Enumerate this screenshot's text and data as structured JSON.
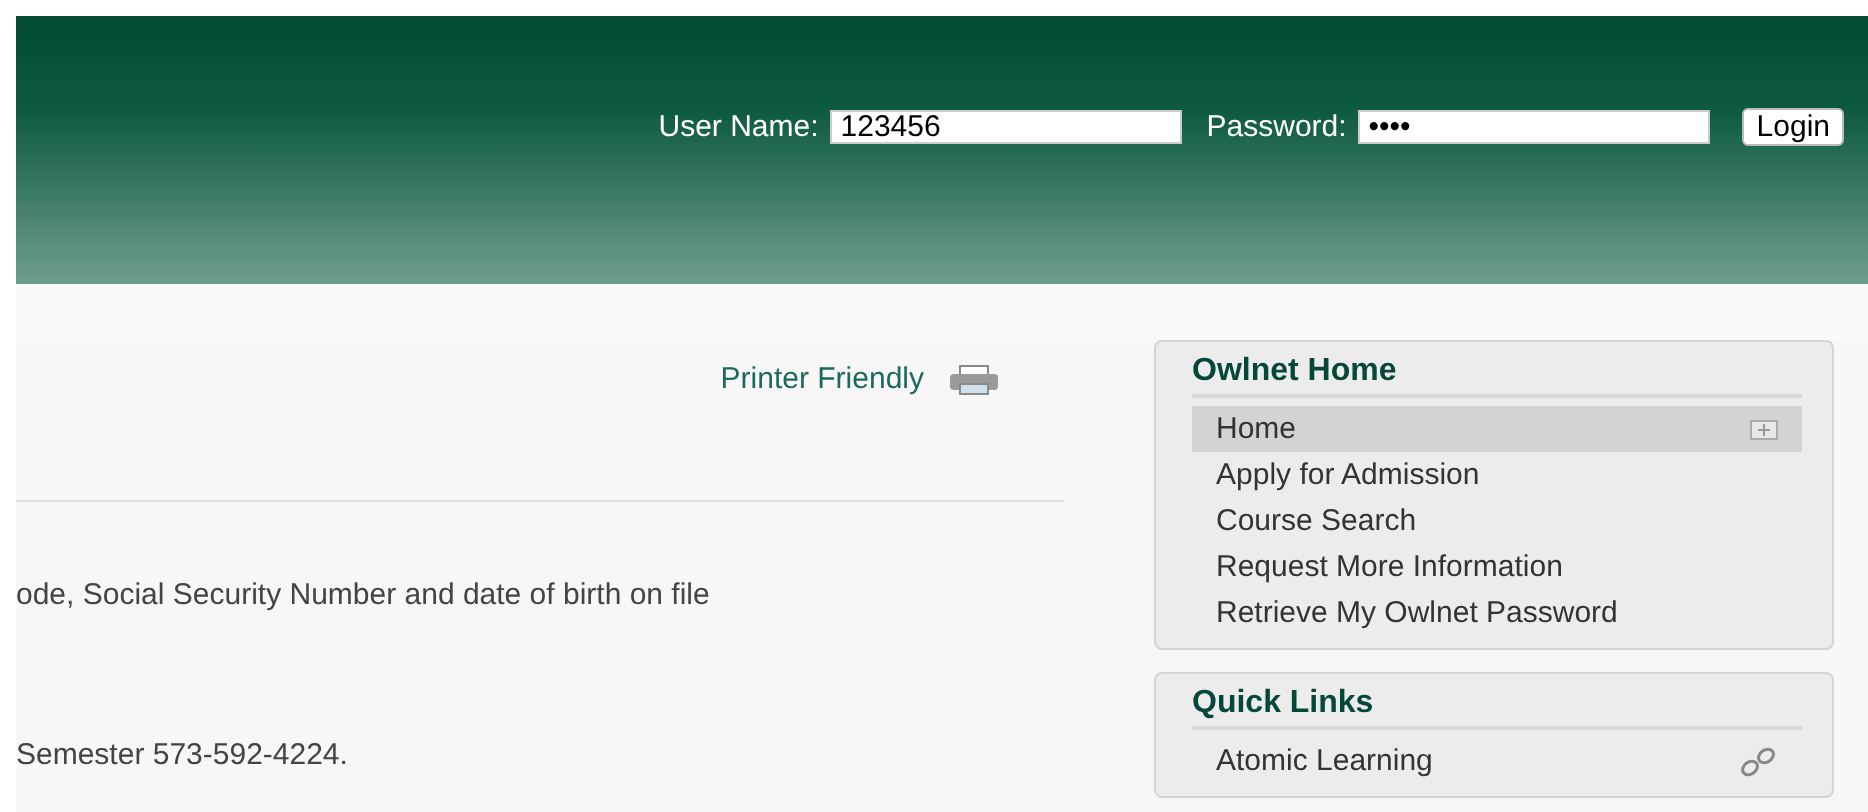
{
  "header": {
    "login": {
      "username_label": "User Name:",
      "username_value": "123456",
      "password_label": "Password:",
      "password_value": "••••",
      "button": "Login"
    }
  },
  "content": {
    "printer_link": "Printer Friendly",
    "paragraphs": [
      "ode, Social Security Number and date of birth on file",
      "Semester 573-592-4224."
    ]
  },
  "sidebar": [
    {
      "title": "Owlnet Home",
      "kind": "nav",
      "items": [
        {
          "label": "Home",
          "selected": true
        },
        {
          "label": "Apply for Admission",
          "selected": false
        },
        {
          "label": "Course Search",
          "selected": false
        },
        {
          "label": "Request More Information",
          "selected": false
        },
        {
          "label": "Retrieve My Owlnet Password",
          "selected": false
        }
      ]
    },
    {
      "title": "Quick Links",
      "kind": "links",
      "items": [
        {
          "label": "Atomic Learning",
          "selected": false
        }
      ]
    }
  ]
}
